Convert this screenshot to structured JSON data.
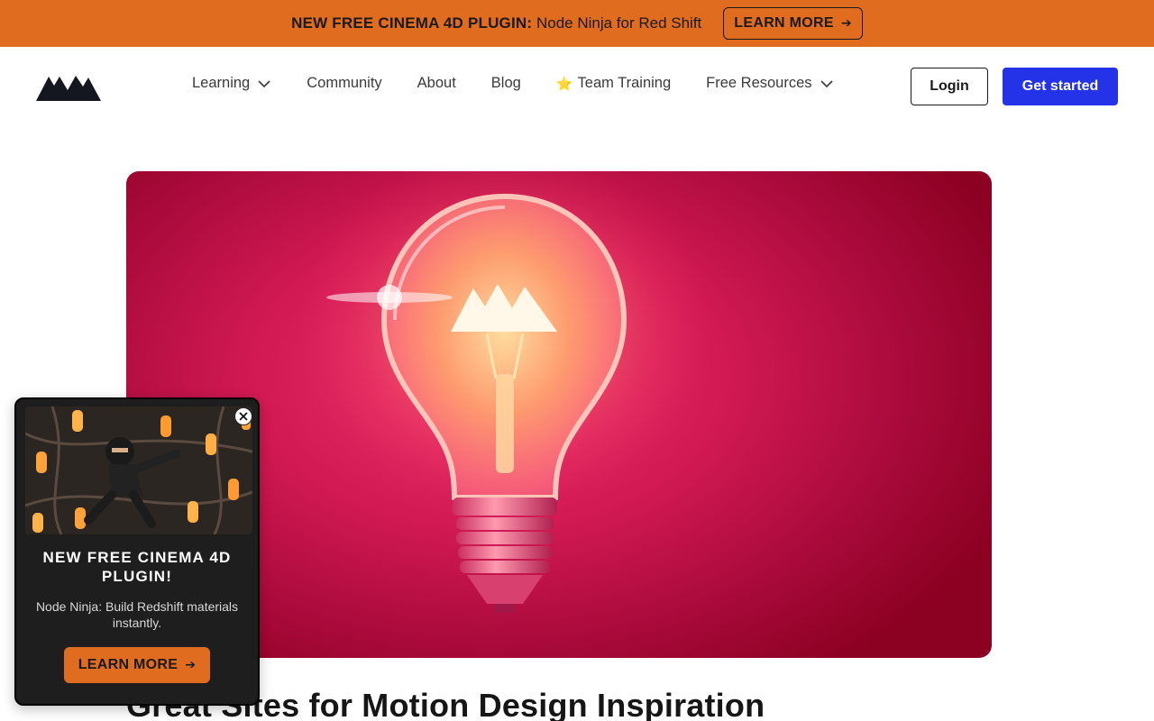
{
  "promo": {
    "headline": "NEW FREE CINEMA 4D PLUGIN:",
    "subtext": "Node Ninja for Red Shift",
    "button_label": "LEARN MORE",
    "button_arrow": "➔"
  },
  "header": {
    "logo_icon": "mountain-logo-icon",
    "nav": [
      {
        "label": "Learning",
        "has_dropdown": true
      },
      {
        "label": "Community"
      },
      {
        "label": "About"
      },
      {
        "label": "Blog"
      },
      {
        "label": "Team Training",
        "icon": "star-icon",
        "glyph": "⭐"
      },
      {
        "label": "Free Resources",
        "has_dropdown": true
      }
    ],
    "login_label": "Login",
    "get_started_label": "Get started"
  },
  "hero": {
    "image_subject": "glowing lightbulb with mountain logo filament on crimson background"
  },
  "article": {
    "title": "Great Sites for Motion Design Inspiration"
  },
  "popup": {
    "title": "NEW FREE CINEMA 4D PLUGIN!",
    "description": "Node Ninja: Build Redshift materials instantly.",
    "button_label": "LEARN MORE",
    "button_arrow": "➔",
    "close_icon": "close-icon"
  },
  "colors": {
    "promo_bg": "#e06c1f",
    "primary_button": "#2432e8",
    "hero_bg": "#d41a55",
    "popup_bg": "#1e1e1e"
  }
}
